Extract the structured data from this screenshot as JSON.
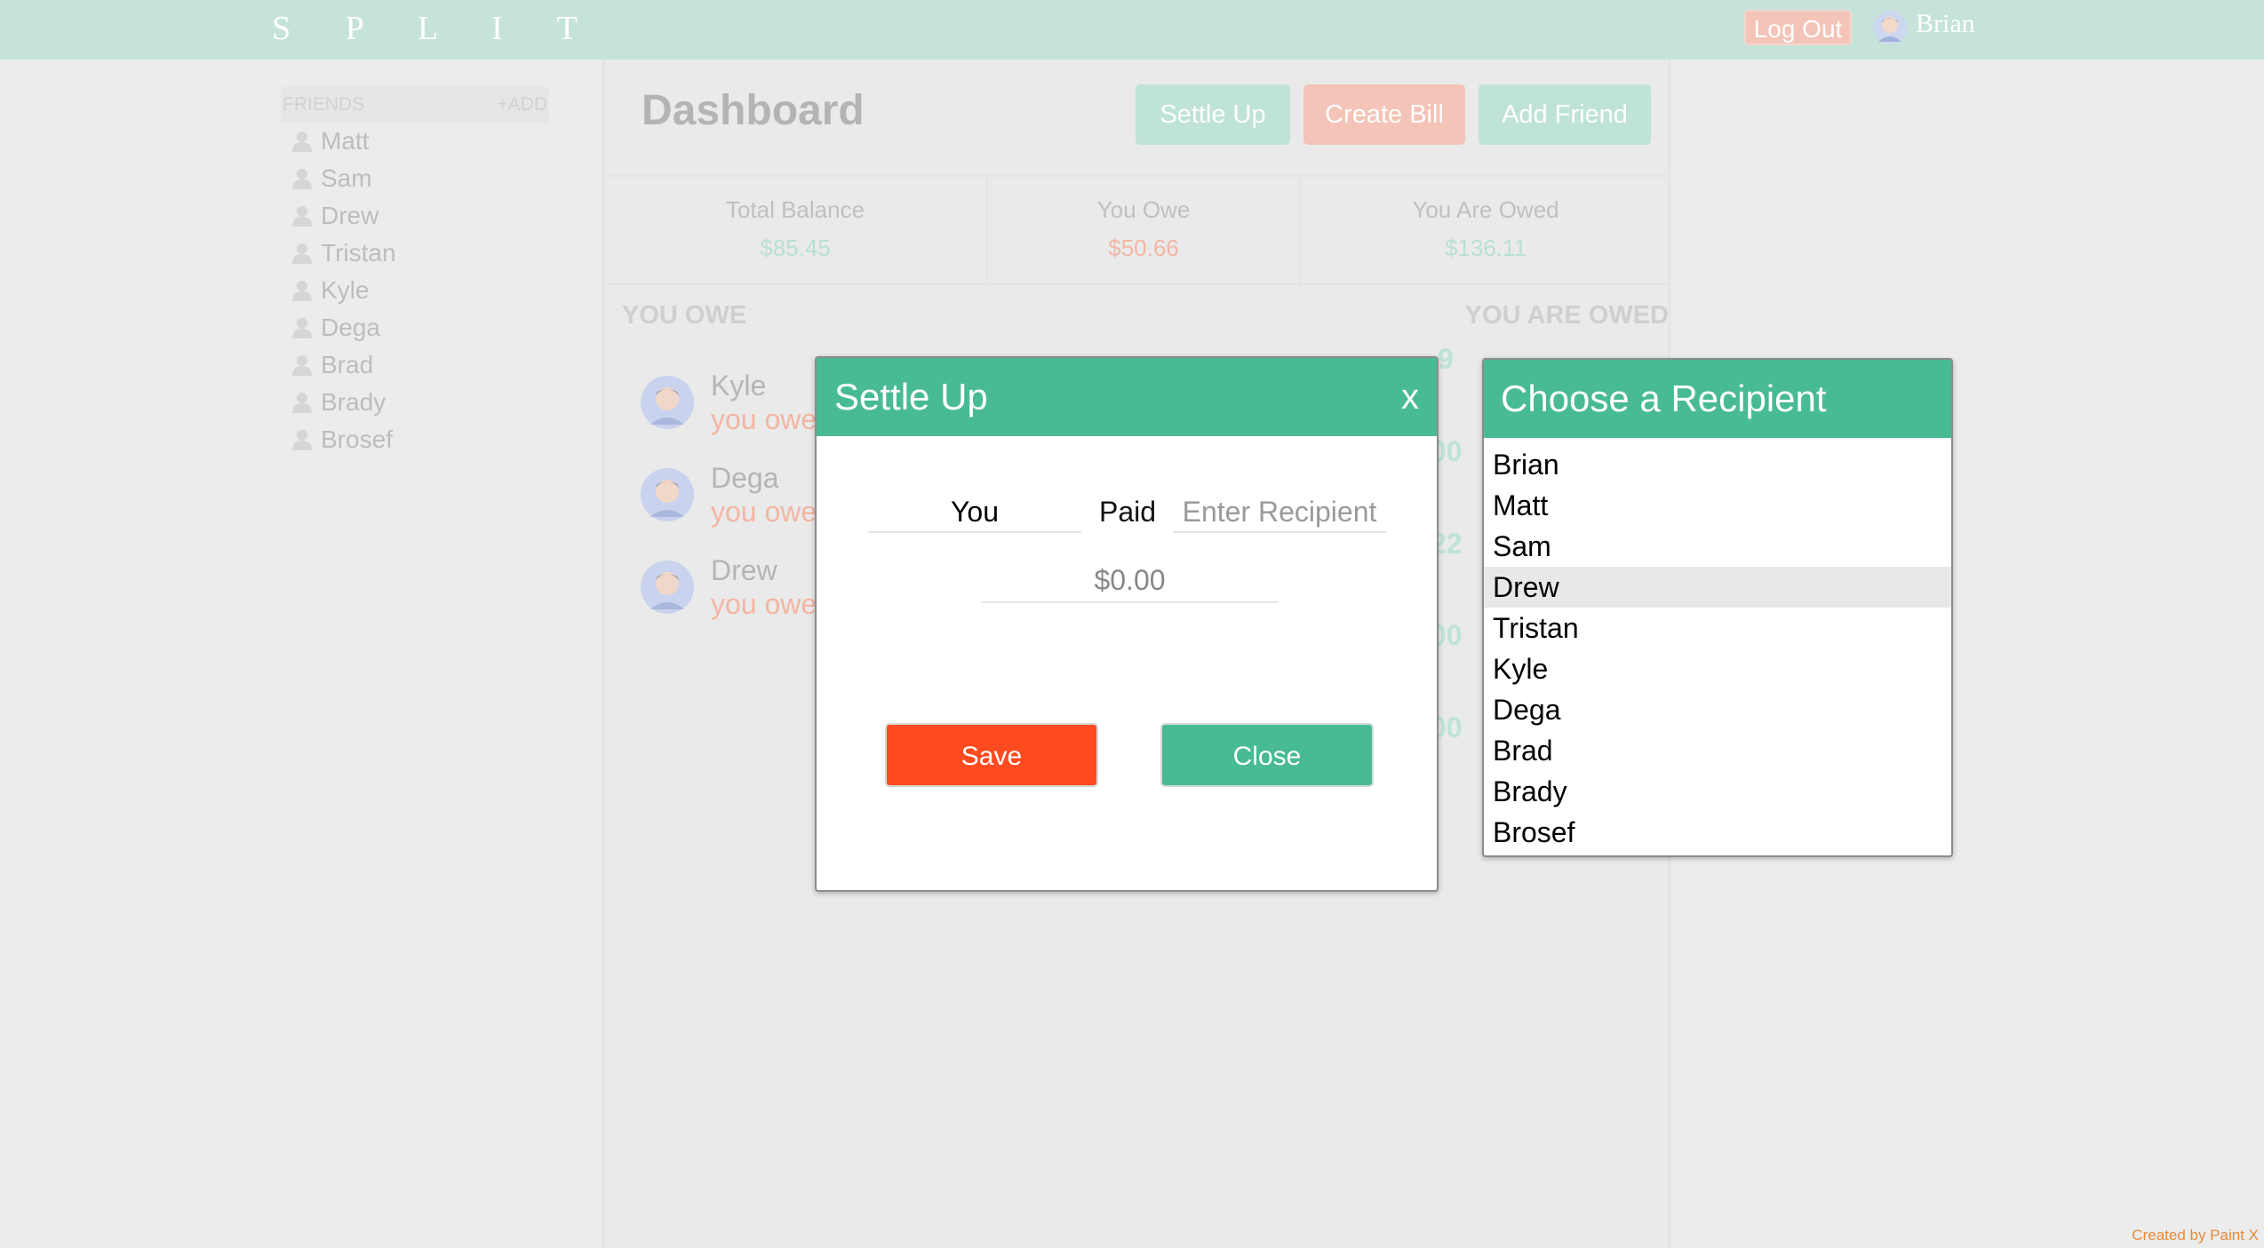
{
  "header": {
    "logo": "S P L I T",
    "logout_label": "Log Out",
    "user_name": "Brian"
  },
  "sidebar": {
    "title": "FRIENDS",
    "add_label": "+ADD",
    "friends": [
      "Matt",
      "Sam",
      "Drew",
      "Tristan",
      "Kyle",
      "Dega",
      "Brad",
      "Brady",
      "Brosef"
    ]
  },
  "dashboard": {
    "title": "Dashboard",
    "buttons": {
      "settle_up": "Settle Up",
      "create_bill": "Create Bill",
      "add_friend": "Add Friend"
    },
    "summary": {
      "total_balance_label": "Total Balance",
      "total_balance": "$85.45",
      "you_owe_label": "You Owe",
      "you_owe": "$50.66",
      "you_are_owed_label": "You Are Owed",
      "you_are_owed": "$136.11"
    },
    "you_owe_heading": "YOU OWE",
    "you_are_owed_heading": "YOU ARE OWED",
    "you_owe_list": [
      {
        "name": "Kyle",
        "sub": "you owe"
      },
      {
        "name": "Dega",
        "sub": "you owe"
      },
      {
        "name": "Drew",
        "sub": "you owe"
      }
    ],
    "owed_fragments": [
      "9",
      "00",
      "22",
      "00",
      "00"
    ]
  },
  "settle_modal": {
    "title": "Settle Up",
    "close_x": "x",
    "payer": "You",
    "paid_label": "Paid",
    "recipient_placeholder": "Enter Recipient",
    "amount": "$0.00",
    "save_label": "Save",
    "close_label": "Close"
  },
  "recipient_picker": {
    "title": "Choose a Recipient",
    "options": [
      "Brian",
      "Matt",
      "Sam",
      "Drew",
      "Tristan",
      "Kyle",
      "Dega",
      "Brad",
      "Brady",
      "Brosef"
    ],
    "highlighted": "Drew"
  },
  "footer": {
    "credit": "Created by Paint X"
  },
  "colors": {
    "accent_green": "#48bb92",
    "save_red": "#ff4b1f",
    "topbar": "#c6e3da"
  }
}
